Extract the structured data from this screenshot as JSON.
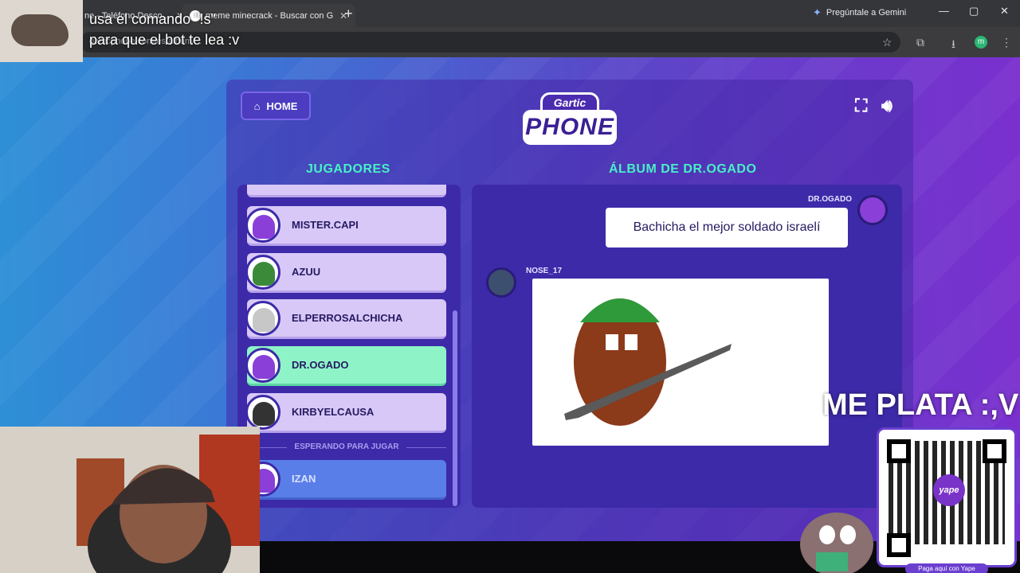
{
  "browser": {
    "tabs": [
      {
        "label": "ne - Teléfono Desco...",
        "close": "✕"
      },
      {
        "label": "meme minecrack - Buscar con G",
        "close": "✕"
      }
    ],
    "new_tab": "+",
    "gemini_label": "Pregúntale a Gemini",
    "url": "garticphone.com/es/album/...",
    "profile_initial": "m",
    "window": {
      "minimize": "—",
      "maximize": "▢",
      "close": "✕"
    }
  },
  "stream": {
    "overlay_line1": "usa el comando \"!s\"",
    "overlay_line2": "para que el bot te lea :v",
    "donation_text": "ME PLATA :,V",
    "qr_brand": "yape",
    "qr_caption": "Paga aquí con Yape"
  },
  "game": {
    "home_label": "HOME",
    "logo_top": "Gartic",
    "logo_bottom": "PHONE",
    "players_title": "JUGADORES",
    "album_title": "ÁLBUM DE DR.OGADO",
    "players": [
      {
        "name": "MISTER.CAPI",
        "color": "#8a3fd8"
      },
      {
        "name": "AZUU",
        "color": "#3a8a3a"
      },
      {
        "name": "ELPERROSALCHICHA",
        "color": "#c7c7c7"
      },
      {
        "name": "DR.OGADO",
        "color": "#8a3fd8"
      },
      {
        "name": "KIRBYELCAUSA",
        "color": "#333333"
      }
    ],
    "waiting_label": "ESPERANDO PARA JUGAR",
    "waiting_players": [
      {
        "name": "IZAN",
        "color": "#8a3fd8"
      }
    ],
    "album": {
      "first_author": "DR.OGADO",
      "phrase": "Bachicha el mejor soldado israelí",
      "second_author": "NOSE_17"
    }
  }
}
